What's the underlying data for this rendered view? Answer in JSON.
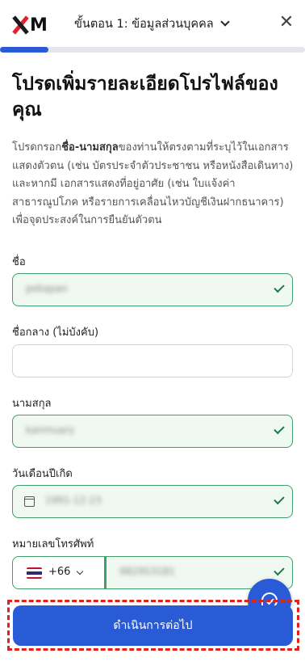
{
  "brand": {
    "logo_text": "XM",
    "accent": "#2a5bd7",
    "logo_red": "#e51f2b"
  },
  "header": {
    "step_label": "ขั้นตอน 1: ข้อมูลส่วนบุคคล",
    "close_icon": "close-icon",
    "progress_fraction": 0.16
  },
  "main": {
    "title": "โปรดเพิ่มรายละเอียดโปรไฟล์ของคุณ",
    "intro_prefix": "โปรดกรอก",
    "intro_bold": "ชื่อ-นามสกุล",
    "intro_rest": "ของท่านให้ตรงตามที่ระบุไว้ในเอกสารแสดงตัวตน (เช่น บัตรประจำตัวประชาชน หรือหนังสือเดินทาง) และหากมี เอกสารแสดงที่อยู่อาศัย (เช่น ใบแจ้งค่าสาธารณูปโภค หรือรายการเคลื่อนไหวบัญชีเงินฝากธนาคาร) เพื่อจุดประสงค์ในการยืนยันตัวตน"
  },
  "form": {
    "first_name": {
      "label": "ชื่อ",
      "value": "pekapan",
      "valid": true
    },
    "middle_name": {
      "label": "ชื่อกลาง (ไม่บังคับ)",
      "value": ""
    },
    "last_name": {
      "label": "นามสกุล",
      "value": "kanmuary",
      "valid": true
    },
    "dob": {
      "label": "วันเดือนปีเกิด",
      "value": "1991-12-23",
      "valid": true
    },
    "phone": {
      "label": "หมายเลขโทรศัพท์",
      "country_code": "+66",
      "number": "982953181",
      "valid": true
    }
  },
  "footer": {
    "continue_label": "ดำเนินการต่อไป"
  }
}
